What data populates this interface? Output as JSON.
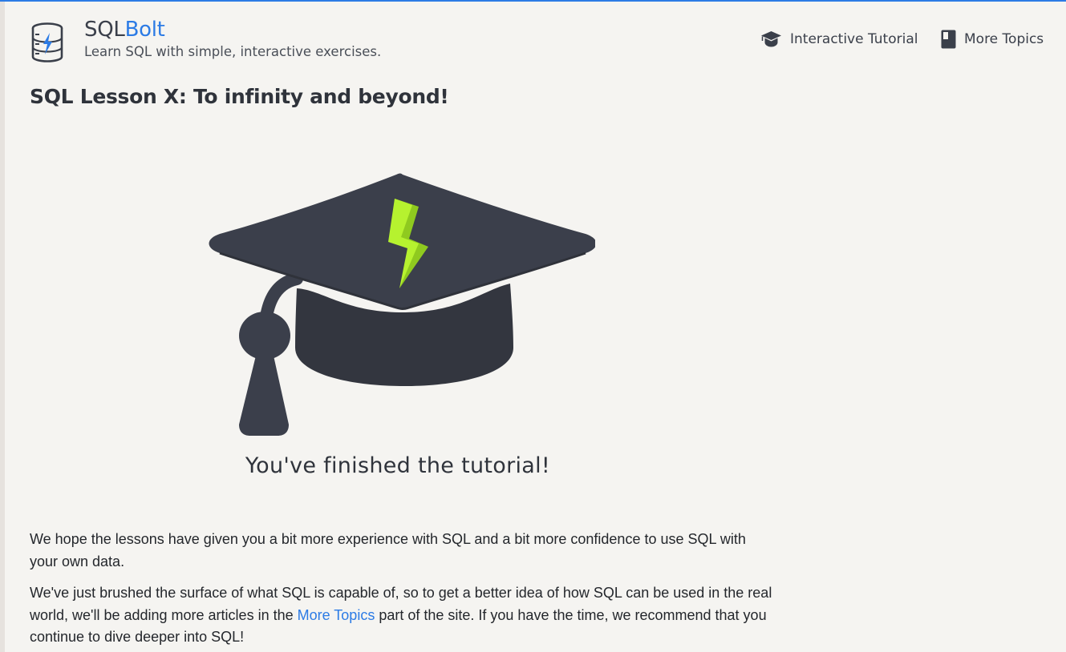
{
  "brand": {
    "name_part1": "SQL",
    "name_part2": "Bolt",
    "tagline": "Learn SQL with simple, interactive exercises."
  },
  "nav": {
    "tutorial_label": "Interactive Tutorial",
    "topics_label": "More Topics"
  },
  "lesson": {
    "title": "SQL Lesson X: To infinity and beyond!",
    "finished_text": "You've finished the tutorial!",
    "paragraph1": "We hope the lessons have given you a bit more experience with SQL and a bit more confidence to use SQL with your own data.",
    "paragraph2_before_link": "We've just brushed the surface of what SQL is capable of, so to get a better idea of how SQL can be used in the real world, we'll be adding more articles in the ",
    "paragraph2_link": "More Topics",
    "paragraph2_after_link": " part of the site. If you have the time, we recommend that you continue to dive deeper into SQL!"
  },
  "icons": {
    "logo": "database-bolt-icon",
    "tutorial": "graduation-cap-icon",
    "topics": "book-icon",
    "hero": "graduation-cap-bolt-illustration"
  },
  "colors": {
    "accent": "#2c7be5",
    "cap": "#3b3f4b",
    "bolt": "#a6e22e",
    "background": "#f5f4f1"
  }
}
